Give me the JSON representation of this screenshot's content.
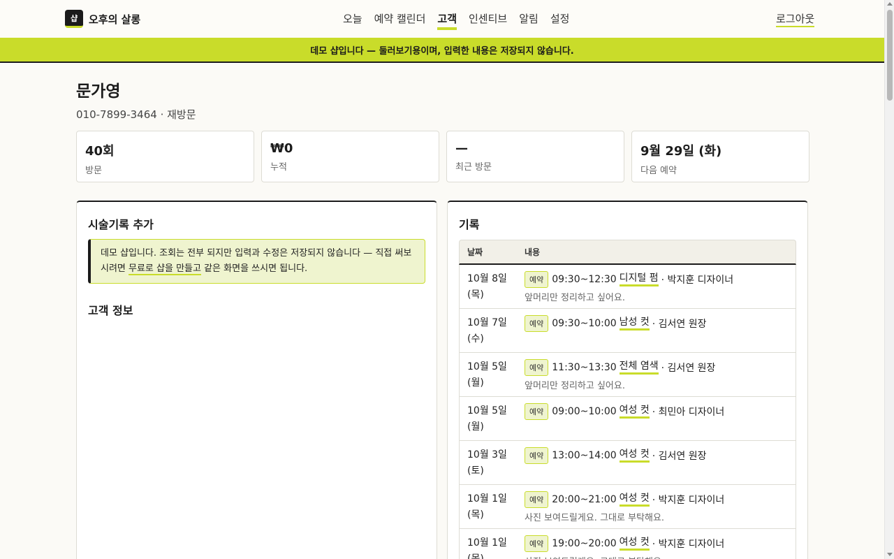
{
  "brand": {
    "logo": "샵",
    "name": "오후의 살롱"
  },
  "nav": [
    "오늘",
    "예약 캘린더",
    "고객",
    "인센티브",
    "알림",
    "설정"
  ],
  "nav_active": "고객",
  "logout": "로그아웃",
  "banner": "데모 샵입니다 — 둘러보기용이며, 입력한 내용은 저장되지 않습니다.",
  "customer": {
    "name": "문가영",
    "meta": "010-7899-3464 · 재방문"
  },
  "stats": [
    {
      "value": "40회",
      "label": "방문"
    },
    {
      "value": "₩0",
      "label": "누적"
    },
    {
      "value": "—",
      "label": "최근 방문"
    },
    {
      "value": "9월 29일 (화)",
      "label": "다음 예약"
    }
  ],
  "left_panel": {
    "title": "시술기록 추가",
    "notice_before": "데모 샵입니다. 조회는 전부 되지만 입력과 수정은 저장되지 않습니다 — 직접 써보시려면 ",
    "notice_link": "무료로 샵을 만들고",
    "notice_after": " 같은 화면을 쓰시면 됩니다.",
    "section": "고객 정보"
  },
  "right_panel": {
    "title": "기록",
    "columns": [
      "날짜",
      "내용"
    ],
    "rows": [
      {
        "date": "10월 8일",
        "day": "(목)",
        "tag": "예약",
        "time": "09:30~12:30",
        "service": "디지털 펌",
        "staff": "· 박지훈 디자이너",
        "memo": "앞머리만 정리하고 싶어요."
      },
      {
        "date": "10월 7일",
        "day": "(수)",
        "tag": "예약",
        "time": "09:30~10:00",
        "service": "남성 컷",
        "staff": "· 김서연 원장",
        "memo": ""
      },
      {
        "date": "10월 5일",
        "day": "(월)",
        "tag": "예약",
        "time": "11:30~13:30",
        "service": "전체 염색",
        "staff": "· 김서연 원장",
        "memo": "앞머리만 정리하고 싶어요."
      },
      {
        "date": "10월 5일",
        "day": "(월)",
        "tag": "예약",
        "time": "09:00~10:00",
        "service": "여성 컷",
        "staff": "· 최민아 디자이너",
        "memo": ""
      },
      {
        "date": "10월 3일",
        "day": "(토)",
        "tag": "예약",
        "time": "13:00~14:00",
        "service": "여성 컷",
        "staff": "· 김서연 원장",
        "memo": ""
      },
      {
        "date": "10월 1일",
        "day": "(목)",
        "tag": "예약",
        "time": "20:00~21:00",
        "service": "여성 컷",
        "staff": "· 박지훈 디자이너",
        "memo": "사진 보여드릴게요. 그대로 부탁해요."
      },
      {
        "date": "10월 1일",
        "day": "(목)",
        "tag": "예약",
        "time": "19:00~20:00",
        "service": "여성 컷",
        "staff": "· 박지훈 디자이너",
        "memo": "사진 보여드릴게요. 그대로 부탁해요."
      }
    ]
  }
}
